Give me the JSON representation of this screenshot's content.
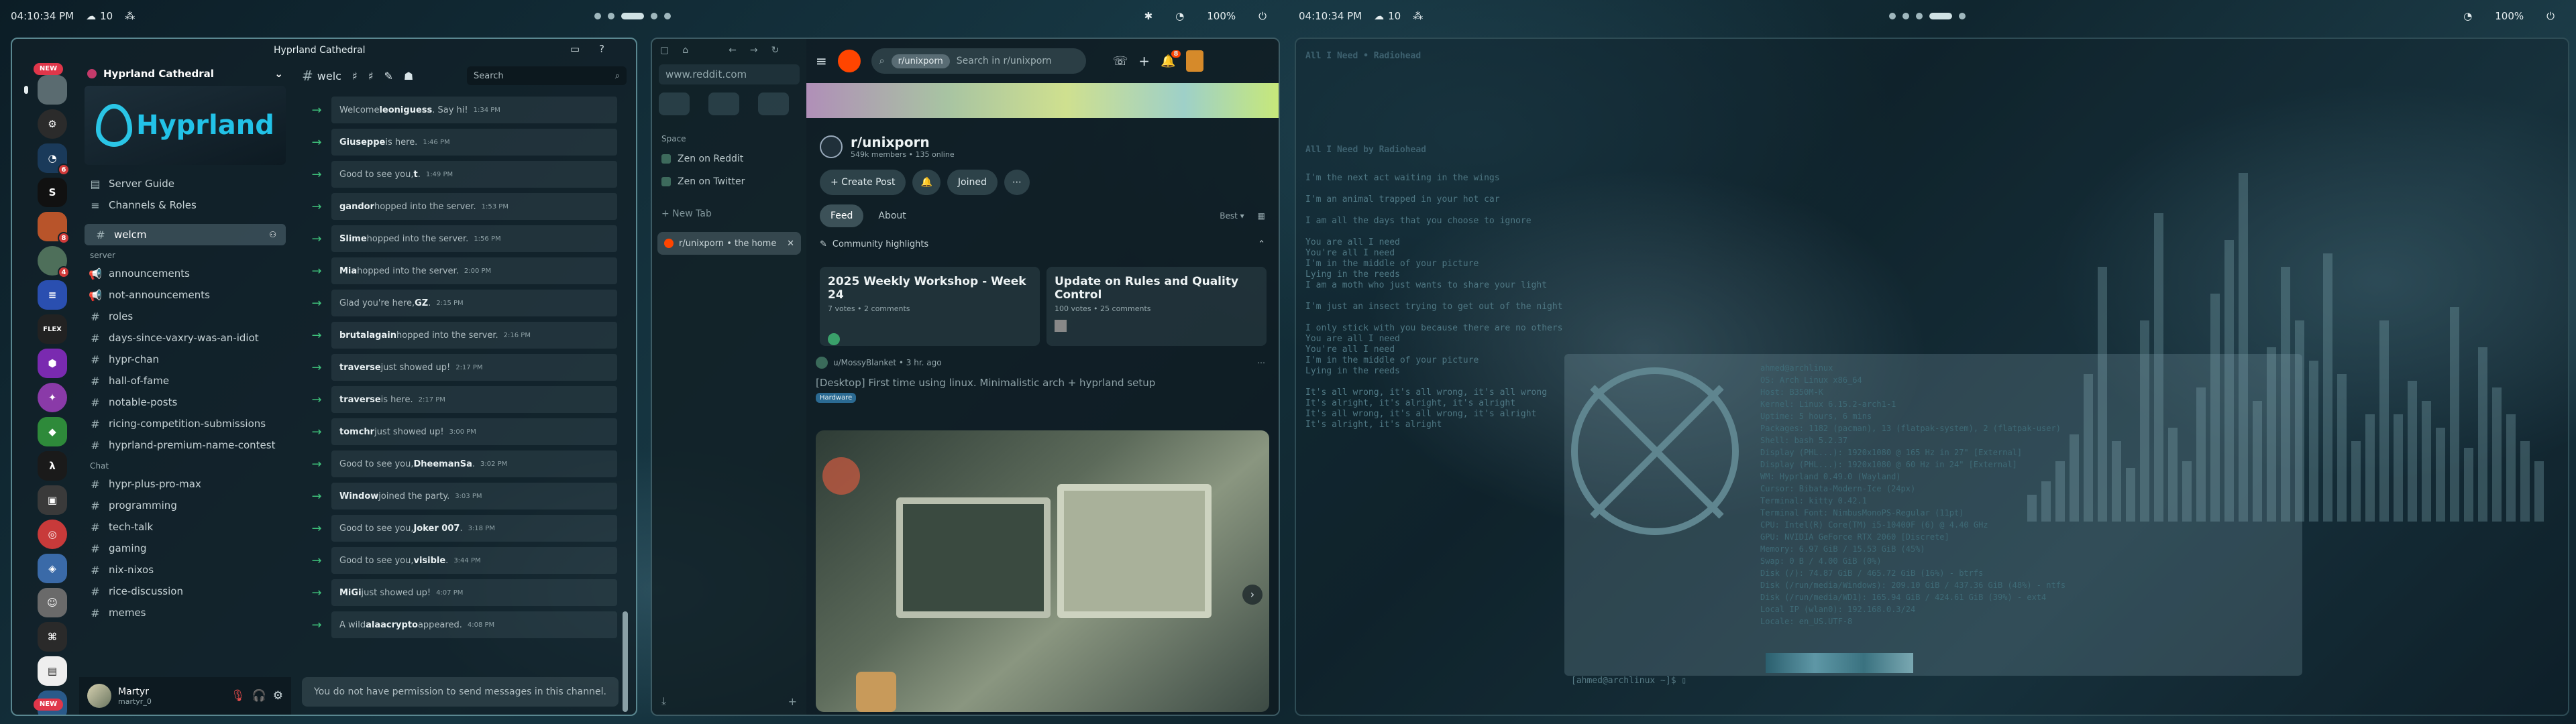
{
  "topbars": [
    {
      "clock": "04:10:34 PM",
      "temp": "10",
      "fan": "⁂"
    },
    {
      "clock": "04:10:34 PM",
      "temp": "10",
      "fan": "⁂"
    }
  ],
  "status": {
    "battery": "100%"
  },
  "discord": {
    "window_title": "Hyprland Cathedral",
    "guild_name": "Hyprland Cathedral",
    "banner_text": "Hyprland",
    "nav": [
      {
        "label": "Server Guide"
      },
      {
        "label": "Channels & Roles"
      }
    ],
    "selected_channel": "welcm",
    "categories": {
      "server": "server",
      "chat": "Chat"
    },
    "server_channels": [
      "announcements",
      "not-announcements",
      "roles",
      "days-since-vaxry-was-an-idiot",
      "hypr-chan",
      "hall-of-fame",
      "notable-posts",
      "ricing-competition-submissions",
      "hyprland-premium-name-contest"
    ],
    "chat_channels": [
      "hypr-plus-pro-max",
      "programming",
      "tech-talk",
      "gaming",
      "nix-nixos",
      "rice-discussion",
      "memes"
    ],
    "new_badge": "NEW",
    "server_badges": [
      "",
      "",
      "6",
      "",
      "8",
      "4",
      "",
      "",
      "",
      "",
      "",
      "",
      "",
      "",
      "",
      "",
      "",
      "",
      "",
      "",
      "",
      ""
    ],
    "header_channel": "welc",
    "search_placeholder": "Search",
    "messages": [
      {
        "pre": "Welcome ",
        "name": "leoniguess",
        "post": ". Say hi!",
        "time": "1:34 PM"
      },
      {
        "pre": "",
        "name": "Giuseppe",
        "post": " is here.",
        "time": "1:46 PM"
      },
      {
        "pre": "Good to see you, ",
        "name": "t",
        "post": ".",
        "time": "1:49 PM"
      },
      {
        "pre": "",
        "name": "gandor",
        "post": " hopped into the server.",
        "time": "1:53 PM"
      },
      {
        "pre": "",
        "name": "Slime",
        "post": " hopped into the server.",
        "time": "1:56 PM"
      },
      {
        "pre": "",
        "name": "Mia",
        "post": " hopped into the server.",
        "time": "2:00 PM"
      },
      {
        "pre": "Glad you're here, ",
        "name": "GZ",
        "post": ".",
        "time": "2:15 PM"
      },
      {
        "pre": "",
        "name": "brutalagain",
        "post": " hopped into the server.",
        "time": "2:16 PM"
      },
      {
        "pre": "",
        "name": "traverse",
        "post": " just showed up!",
        "time": "2:17 PM"
      },
      {
        "pre": "",
        "name": "traverse",
        "post": " is here.",
        "time": "2:17 PM"
      },
      {
        "pre": "",
        "name": "tomchr",
        "post": " just showed up!",
        "time": "3:00 PM"
      },
      {
        "pre": "Good to see you, ",
        "name": "DheemanSa",
        "post": ".",
        "time": "3:02 PM"
      },
      {
        "pre": "",
        "name": "Window",
        "post": " joined the party.",
        "time": "3:03 PM"
      },
      {
        "pre": "Good to see you, ",
        "name": "Joker 007",
        "post": ".",
        "time": "3:18 PM"
      },
      {
        "pre": "Good to see you, ",
        "name": "visible",
        "post": ".",
        "time": "3:44 PM"
      },
      {
        "pre": "",
        "name": "MiGi",
        "post": " just showed up!",
        "time": "4:07 PM"
      },
      {
        "pre": "A wild ",
        "name": "alaacrypto",
        "post": " appeared.",
        "time": "4:08 PM"
      }
    ],
    "no_permission": "You do not have permission to send messages in this channel.",
    "user": {
      "name": "Martyr",
      "tag": "martyr_0"
    }
  },
  "browser": {
    "url": "www.reddit.com",
    "space_label": "Space",
    "pinned": [
      "Zen on Reddit",
      "Zen on Twitter"
    ],
    "new_tab": "+ New Tab",
    "tab_title": "r/unixporn • the home",
    "reddit": {
      "search_chip": "r/unixporn",
      "search_placeholder": "Search in r/unixporn",
      "notif_count": "8",
      "sub_name": "r/unixporn",
      "sub_stats": "549k members  •  135 online",
      "create_post": "+ Create Post",
      "joined": "Joined",
      "tabs": [
        "Feed",
        "About"
      ],
      "sort": "Best ▾",
      "highlights": "Community highlights",
      "cards": [
        {
          "title": "2025 Weekly Workshop - Week 24",
          "sub": "7 votes • 2 comments"
        },
        {
          "title": "Update on Rules and Quality Control",
          "sub": "100 votes • 25 comments"
        }
      ],
      "post_user": "u/MossyBlanket • 3 hr. ago",
      "post_title": "[Desktop] First time using linux. Minimalistic arch + hyprland setup",
      "post_flair": "Hardware"
    }
  },
  "terminal": {
    "song_title": "All I Need • Radiohead",
    "song_heading": "All I Need by Radiohead",
    "prompt": "[ahmed@archlinux ~]$",
    "lyrics": [
      "I'm the next act waiting in the wings",
      "",
      "I'm an animal trapped in your hot car",
      "",
      "I am all the days that you choose to ignore",
      "",
      "You are all I need",
      "You're all I need",
      "I'm in the middle of your picture",
      "Lying in the reeds",
      "I am a moth who just wants to share your light",
      "",
      "I'm just an insect trying to get out of the night",
      "",
      "I only stick with you because there are no others",
      "You are all I need",
      "You're all I need",
      "I'm in the middle of your picture",
      "Lying in the reeds",
      "",
      "It's all wrong, it's all wrong, it's all wrong",
      "It's alright, it's alright, it's alright",
      "It's all wrong, it's all wrong, it's alright",
      "It's alright, it's alright"
    ],
    "fastfetch": [
      "ahmed@archlinux",
      "OS: Arch Linux x86_64",
      "Host: B350M-K",
      "Kernel: Linux 6.15.2-arch1-1",
      "Uptime: 5 hours, 6 mins",
      "Packages: 1182 (pacman), 13 (flatpak-system), 2 (flatpak-user)",
      "Shell: bash 5.2.37",
      "Display (PHL...): 1920x1080 @ 165 Hz in 27\" [External]",
      "Display (PHL...): 1920x1080 @ 60 Hz in 24\" [External]",
      "WM: Hyprland 0.49.0 (Wayland)",
      "Cursor: Bibata-Modern-Ice (24px)",
      "Terminal: kitty 0.42.1",
      "Terminal Font: NimbusMonoPS-Regular (11pt)",
      "CPU: Intel(R) Core(TM) i5-10400F (6) @ 4.40 GHz",
      "GPU: NVIDIA GeForce RTX 2060 [Discrete]",
      "Memory: 6.97 GiB / 15.53 GiB (45%)",
      "Swap: 0 B / 4.00 GiB (0%)",
      "Disk (/): 74.87 GiB / 465.72 GiB (16%) - btrfs",
      "Disk (/run/media/Windows): 209.10 GiB / 437.36 GiB (48%) - ntfs",
      "Disk (/run/media/WD1): 165.94 GiB / 424.61 GiB (39%) - ext4",
      "Local IP (wlan0): 192.168.0.3/24",
      "Locale: en_US.UTF-8"
    ],
    "prompt_end": "[ahmed@archlinux ~]$ ▯"
  }
}
